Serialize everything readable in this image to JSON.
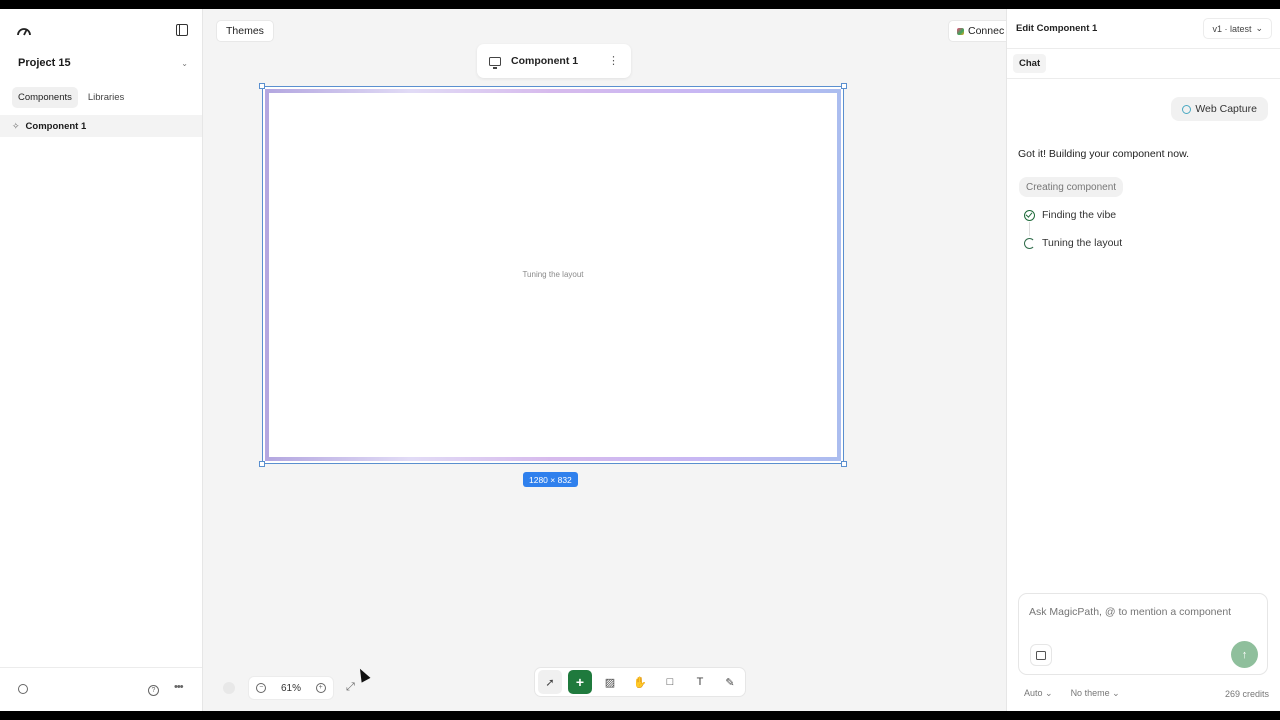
{
  "sidebar": {
    "project_name": "Project 15",
    "tabs": [
      "Components",
      "Libraries"
    ],
    "components": [
      {
        "label": "Component 1"
      }
    ]
  },
  "canvas": {
    "themes_label": "Themes",
    "connect_label": "Connec",
    "frame_title": "Component 1",
    "frame_status": "Tuning the layout",
    "frame_size": "1280 × 832",
    "zoom": "61%"
  },
  "panel": {
    "title": "Edit Component 1",
    "version": "v1 · latest",
    "tab": "Chat",
    "user_message": "Web Capture",
    "assistant_message": "Got it! Building your component now.",
    "creating_label": "Creating component",
    "steps": [
      {
        "label": "Finding the vibe",
        "status": "done"
      },
      {
        "label": "Tuning the layout",
        "status": "in-progress"
      }
    ],
    "composer_placeholder": "Ask MagicPath, @ to mention a component",
    "model_select": "Auto",
    "theme_select": "No theme",
    "credits": "269 credits"
  },
  "colors": {
    "accent": "#1f7a3d",
    "selection": "#2f80ed"
  }
}
